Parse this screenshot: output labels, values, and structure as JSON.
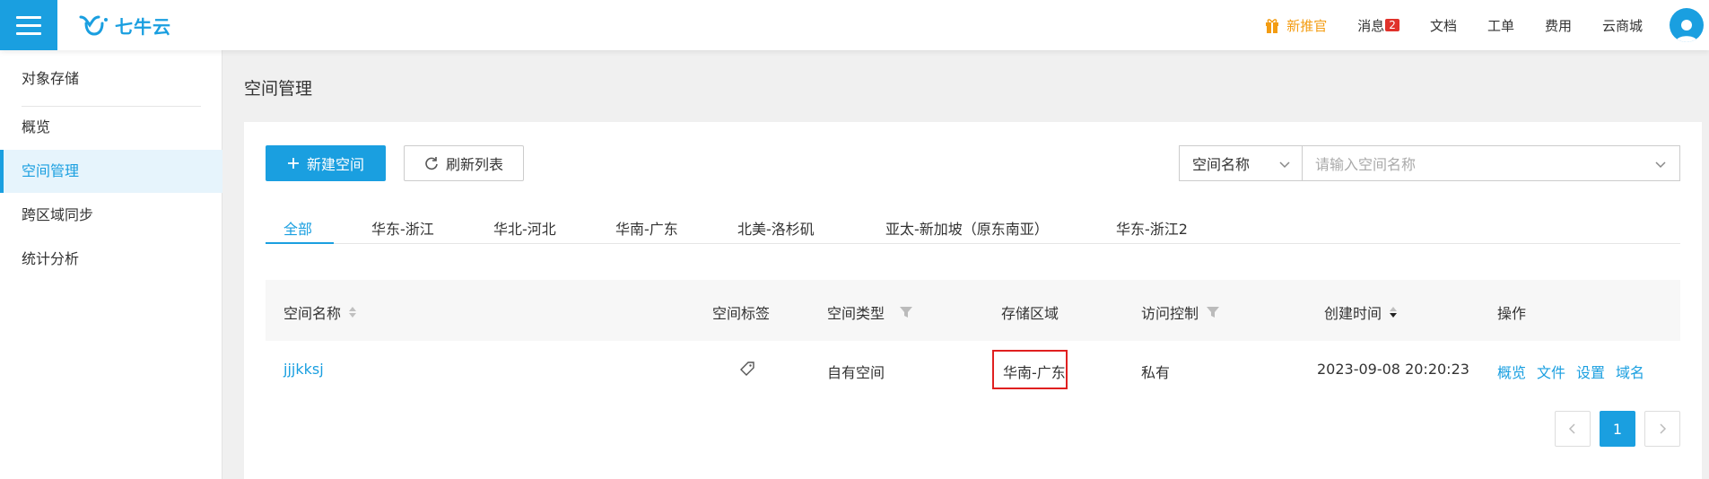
{
  "topbar": {
    "logo_text": "七牛云",
    "nav": {
      "promo": "新推官",
      "messages": "消息",
      "messages_count": "2",
      "docs": "文档",
      "tickets": "工单",
      "billing": "费用",
      "store": "云商城"
    }
  },
  "sidebar": {
    "title": "对象存储",
    "items": [
      {
        "label": "概览"
      },
      {
        "label": "空间管理",
        "active": true
      },
      {
        "label": "跨区域同步"
      },
      {
        "label": "统计分析"
      }
    ]
  },
  "page": {
    "title": "空间管理"
  },
  "toolbar": {
    "create_label": "新建空间",
    "refresh_label": "刷新列表",
    "search_field": "空间名称",
    "search_placeholder": "请输入空间名称"
  },
  "tabs": [
    "全部",
    "华东-浙江",
    "华北-河北",
    "华南-广东",
    "北美-洛杉矶",
    "亚太-新加坡（原东南亚）",
    "华东-浙江2"
  ],
  "table": {
    "columns": {
      "name": "空间名称",
      "tag": "空间标签",
      "type": "空间类型",
      "region": "存储区域",
      "access": "访问控制",
      "created": "创建时间",
      "ops": "操作"
    },
    "rows": [
      {
        "name": "jjjkksj",
        "type": "自有空间",
        "region": "华南-广东",
        "access": "私有",
        "created": "2023-09-08 20:20:23",
        "ops": [
          "概览",
          "文件",
          "设置",
          "域名"
        ]
      }
    ]
  },
  "pagination": {
    "current": "1"
  },
  "colors": {
    "accent": "#1a9fe0",
    "promo": "#f39c12",
    "highlight": "#e02020"
  }
}
